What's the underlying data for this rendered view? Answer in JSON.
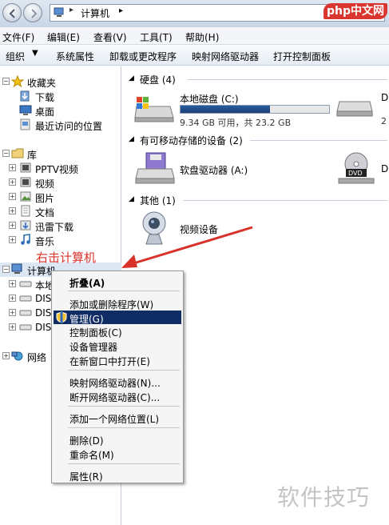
{
  "address": {
    "location": "计算机"
  },
  "watermark_top": "php中文网",
  "menu": {
    "items": [
      "文件(F)",
      "编辑(E)",
      "查看(V)",
      "工具(T)",
      "帮助(H)"
    ]
  },
  "toolbar": {
    "organize": "组织",
    "items": [
      "系统属性",
      "卸载或更改程序",
      "映射网络驱动器",
      "打开控制面板"
    ]
  },
  "nav": {
    "favorites": {
      "label": "收藏夹",
      "children": [
        "下载",
        "桌面",
        "最近访问的位置"
      ]
    },
    "libraries": {
      "label": "库",
      "children": [
        "PPTV视频",
        "视频",
        "图片",
        "文档",
        "迅雷下载",
        "音乐"
      ]
    },
    "computer": {
      "label": "计算机",
      "children": [
        "本地",
        "DIS",
        "DIS",
        "DIS"
      ]
    },
    "network": {
      "label": "网络"
    }
  },
  "annotation": "右击计算机",
  "content": {
    "groups": [
      {
        "title": "硬盘 (4)"
      },
      {
        "title": "有可移动存储的设备 (2)"
      },
      {
        "title": "其他 (1)"
      }
    ],
    "local_disk": {
      "name": "本地磁盘 (C:)",
      "info": "9.34 GB 可用，共 23.2 GB",
      "used_fraction": 0.6
    },
    "disk_d": {
      "name": "D",
      "info": "2"
    },
    "floppy": {
      "name": "软盘驱动器 (A:)"
    },
    "dvd": {
      "name": "D"
    },
    "video_device": {
      "name": "视频设备"
    }
  },
  "context_menu": {
    "items": [
      "折叠(A)",
      "添加或删除程序(W)",
      "管理(G)",
      "控制面板(C)",
      "设备管理器",
      "在新窗口中打开(E)",
      "映射网络驱动器(N)...",
      "断开网络驱动器(C)...",
      "添加一个网络位置(L)",
      "删除(D)",
      "重命名(M)",
      "属性(R)"
    ]
  },
  "watermark_bottom": "软件技巧"
}
